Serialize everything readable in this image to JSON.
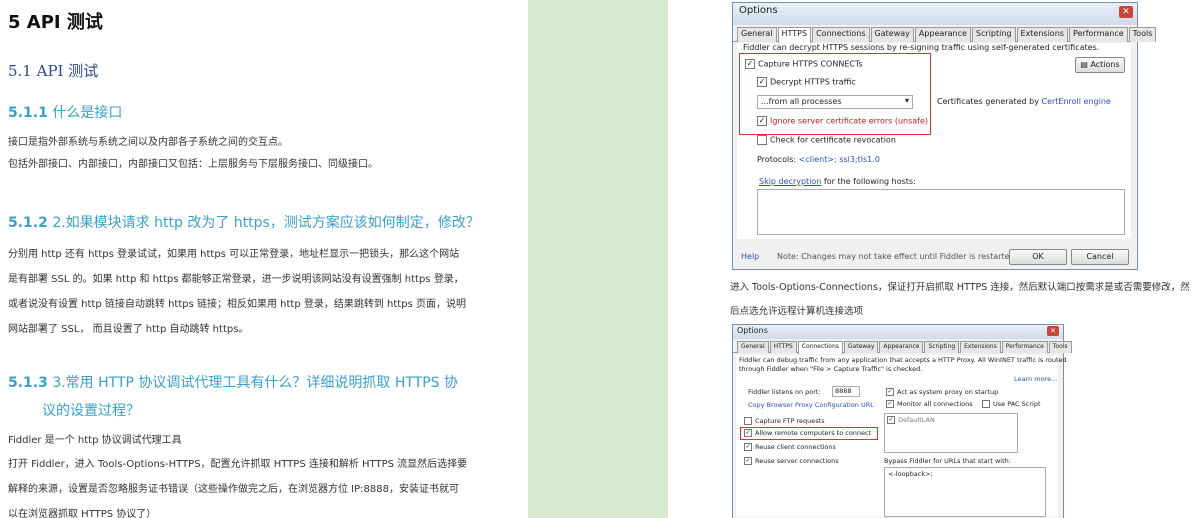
{
  "doc": {
    "h1": "5  API  测试",
    "h2": "5.1 API 测试",
    "s1_num": "5.1.1",
    "s1_title": " 什么是接口",
    "s1_p1": "接口是指外部系统与系统之间以及内部各子系统之间的交互点。",
    "s1_p2": "包括外部接口、内部接口，内部接口又包括：上层服务与下层服务接口、同级接口。",
    "s2_num": "5.1.2",
    "s2_title": " 2.如果模块请求 http 改为了 https，测试方案应该如何制定，修改？",
    "s2_p": "分别用 http 还有 https 登录试试，如果用 https 可以正常登录，地址栏显示一把锁头，那么这个网站是有部署 SSL 的。如果 http 和 https 都能够正常登录，进一步说明该网站没有设置强制 https 登录，或者说没有设置 http 链接自动跳转 https 链接；相反如果用 http 登录，结果跳转到 https 页面，说明网站部署了 SSL， 而且设置了 http 自动跳转 https。",
    "s3_num": "5.1.3",
    "s3_title_a": " 3.常用  HTTP  协议调试代理工具有什么？详细说明抓取  HTTPS  协",
    "s3_title_b": "议的设置过程？",
    "s3_p1": "Fiddler  是一个  http  协议调试代理工具",
    "s3_p2": "打开 Fiddler，进入 Tools-Options-HTTPS，配置允许抓取 HTTPS 连接和解析 HTTPS 流显然后选择要解释的来源，设置是否忽略服务证书错误（这些操作做完之后，在浏览器方位 IP:8888，安装证书就可以在浏览器抓取 HTTPS 协议了）"
  },
  "dialog1": {
    "title": "Options",
    "tabs": [
      "General",
      "HTTPS",
      "Connections",
      "Gateway",
      "Appearance",
      "Scripting",
      "Extensions",
      "Performance",
      "Tools"
    ],
    "intro": "Fiddler can decrypt HTTPS sessions by re-signing traffic using self-generated certificates.",
    "capture": "Capture HTTPS CONNECTs",
    "decrypt": "Decrypt HTTPS traffic",
    "dropdown": "...from all processes",
    "ignore": "Ignore server certificate errors (unsafe)",
    "revocation": "Check for certificate revocation",
    "certs_label": "Certificates generated by ",
    "certs_link": "CertEnroll engine",
    "actions": "Actions",
    "protocols_label": "Protocols: ",
    "protocols_value": "<client>; ssl3;tls1.0",
    "skip_link": "Skip decryption",
    "skip_rest": " for the following hosts:",
    "help": "Help",
    "note": "Note: Changes may not take effect until Fiddler is restarted.",
    "ok": "OK",
    "cancel": "Cancel"
  },
  "caption": "进入 Tools-Options-Connections，保证打开启抓取 HTTPS 连接，然后默认端口按需求是或否需要修改，然后点选允许远程计算机连接选项",
  "dialog2": {
    "title": "Options",
    "tabs": [
      "General",
      "HTTPS",
      "Connections",
      "Gateway",
      "Appearance",
      "Scripting",
      "Extensions",
      "Performance",
      "Tools"
    ],
    "intro1": "Fiddler can debug traffic from any application that accepts a HTTP Proxy. All WinINET traffic is routed",
    "intro2": "through Fiddler when \"File > Capture Traffic\" is checked.",
    "learn_more": "Learn more...",
    "port_label": "Fiddler listens on port:",
    "port_value": "8888",
    "copy_link": "Copy Browser Proxy Configuration URL",
    "ftp": "Capture FTP requests",
    "remote": "Allow remote computers to connect",
    "reuse_client": "Reuse client connections",
    "reuse_server": "Reuse server connections",
    "act_proxy": "Act as system proxy on startup",
    "monitor": "Monitor all connections",
    "use_pac": "Use PAC Script",
    "lan": "DefaultLAN",
    "bypass_label": "Bypass Fiddler for URLs that start with:",
    "bypass_value": "<-loopback>;"
  }
}
